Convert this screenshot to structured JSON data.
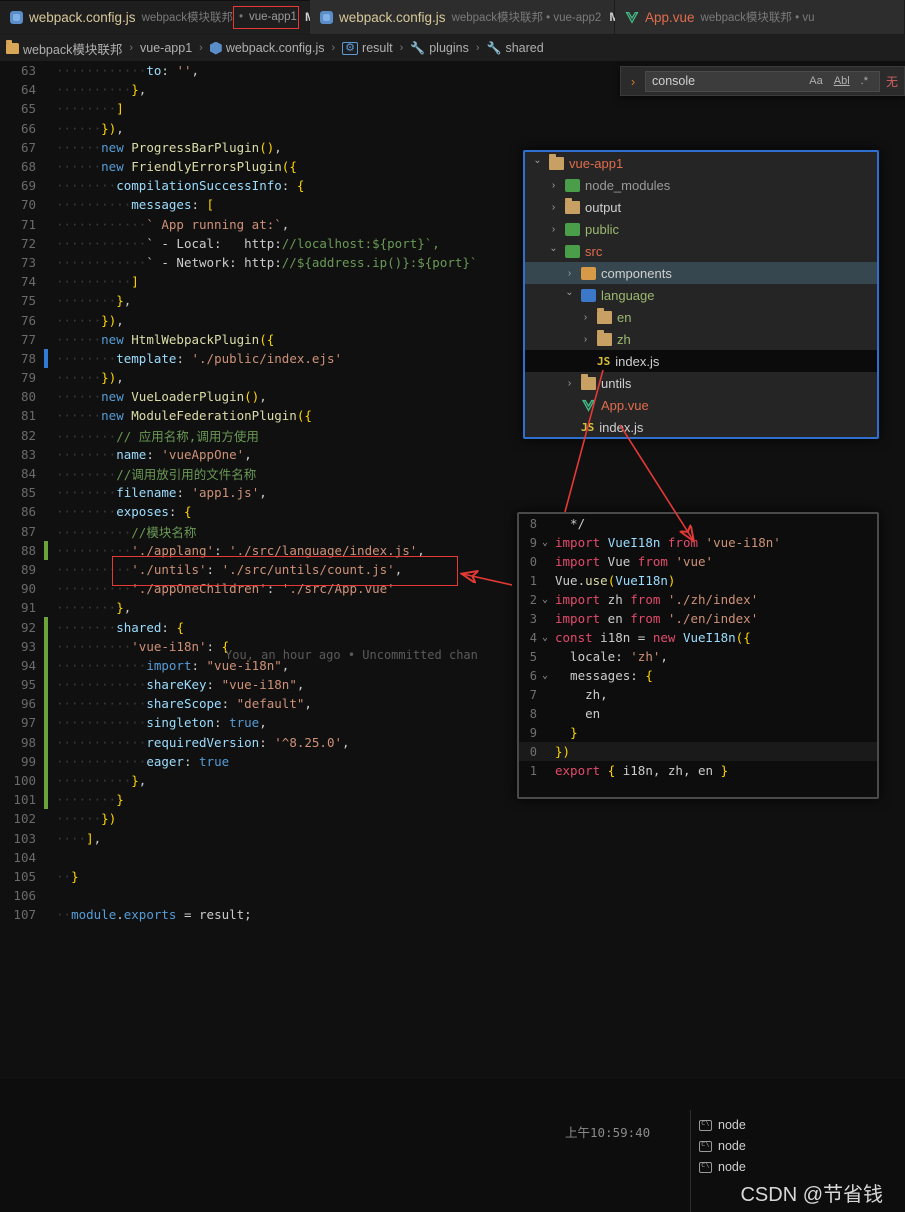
{
  "tabs": [
    {
      "icon": "js-file-icon",
      "name": "webpack.config.js",
      "desc": "webpack模块联邦",
      "sep": "•",
      "project": "vue-app1",
      "modified": "M",
      "close": "✕",
      "active": true
    },
    {
      "icon": "js-file-icon",
      "name": "webpack.config.js",
      "desc": "webpack模块联邦 • vue-app2",
      "modified": "M",
      "active": false
    },
    {
      "icon": "vue-file-icon",
      "name": "App.vue",
      "desc": "webpack模块联邦 • vu",
      "modified": "",
      "active": false
    }
  ],
  "breadcrumb": [
    {
      "icon": "folder-icon",
      "label": "webpack模块联邦"
    },
    {
      "icon": "none",
      "label": "vue-app1"
    },
    {
      "icon": "js-file-icon",
      "label": "webpack.config.js"
    },
    {
      "icon": "object-icon",
      "label": "result"
    },
    {
      "icon": "wrench-icon",
      "label": "plugins"
    },
    {
      "icon": "wrench-icon",
      "label": "shared"
    }
  ],
  "find_widget": {
    "chevron": "›",
    "query": "console",
    "opt_match_case": "Aa",
    "opt_whole_word": "Abl",
    "opt_regex": ".*",
    "result": "无"
  },
  "editor": {
    "blame_annotation": "You, an hour ago • Uncommitted chan",
    "lines": [
      {
        "n": 63,
        "mark": "",
        "text": "            to: '',"
      },
      {
        "n": 64,
        "mark": "",
        "text": "          },"
      },
      {
        "n": 65,
        "mark": "",
        "text": "        ]"
      },
      {
        "n": 66,
        "mark": "",
        "text": "      }),"
      },
      {
        "n": 67,
        "mark": "",
        "text": "      new ProgressBarPlugin(),"
      },
      {
        "n": 68,
        "mark": "",
        "text": "      new FriendlyErrorsPlugin({"
      },
      {
        "n": 69,
        "mark": "",
        "text": "        compilationSuccessInfo: {"
      },
      {
        "n": 70,
        "mark": "",
        "text": "          messages: ["
      },
      {
        "n": 71,
        "mark": "",
        "text": "            ` App running at:`,"
      },
      {
        "n": 72,
        "mark": "",
        "text": "            ` - Local:   http://localhost:${port}`,"
      },
      {
        "n": 73,
        "mark": "",
        "text": "            ` - Network: http://${address.ip()}:${port}`"
      },
      {
        "n": 74,
        "mark": "",
        "text": "          ]"
      },
      {
        "n": 75,
        "mark": "",
        "text": "        },"
      },
      {
        "n": 76,
        "mark": "",
        "text": "      }),"
      },
      {
        "n": 77,
        "mark": "",
        "text": "      new HtmlWebpackPlugin({"
      },
      {
        "n": 78,
        "mark": "blue",
        "text": "        template: './public/index.ejs'"
      },
      {
        "n": 79,
        "mark": "",
        "text": "      }),"
      },
      {
        "n": 80,
        "mark": "",
        "text": "      new VueLoaderPlugin(),"
      },
      {
        "n": 81,
        "mark": "",
        "text": "      new ModuleFederationPlugin({"
      },
      {
        "n": 82,
        "mark": "",
        "text": "        // 应用名称,调用方使用"
      },
      {
        "n": 83,
        "mark": "",
        "text": "        name: 'vueAppOne',"
      },
      {
        "n": 84,
        "mark": "",
        "text": "        //调用放引用的文件名称"
      },
      {
        "n": 85,
        "mark": "",
        "text": "        filename: 'app1.js',"
      },
      {
        "n": 86,
        "mark": "",
        "text": "        exposes: {"
      },
      {
        "n": 87,
        "mark": "",
        "text": "          //模块名称"
      },
      {
        "n": 88,
        "mark": "green",
        "text": "          './applang': './src/language/index.js',"
      },
      {
        "n": 89,
        "mark": "",
        "text": "          './untils': './src/untils/count.js',"
      },
      {
        "n": 90,
        "mark": "",
        "text": "          './appOneChildren': './src/App.vue'"
      },
      {
        "n": 91,
        "mark": "",
        "text": "        },"
      },
      {
        "n": 92,
        "mark": "green",
        "text": "        shared: {"
      },
      {
        "n": 93,
        "mark": "green",
        "text": "          'vue-i18n': {"
      },
      {
        "n": 94,
        "mark": "green",
        "text": "            import: \"vue-i18n\","
      },
      {
        "n": 95,
        "mark": "green",
        "text": "            shareKey: \"vue-i18n\","
      },
      {
        "n": 96,
        "mark": "green",
        "text": "            shareScope: \"default\","
      },
      {
        "n": 97,
        "mark": "green",
        "text": "            singleton: true,"
      },
      {
        "n": 98,
        "mark": "green",
        "text": "            requiredVersion: '^8.25.0',"
      },
      {
        "n": 99,
        "mark": "green",
        "text": "            eager: true"
      },
      {
        "n": 100,
        "mark": "green",
        "text": "          },"
      },
      {
        "n": 101,
        "mark": "green",
        "text": "        }"
      },
      {
        "n": 102,
        "mark": "",
        "text": "      })"
      },
      {
        "n": 103,
        "mark": "",
        "text": "    ],"
      },
      {
        "n": 104,
        "mark": "",
        "text": ""
      },
      {
        "n": 105,
        "mark": "",
        "text": "  }"
      },
      {
        "n": 106,
        "mark": "",
        "text": ""
      },
      {
        "n": 107,
        "mark": "",
        "text": "  module.exports = result;"
      }
    ]
  },
  "file_tree": {
    "rows": [
      {
        "indent": 0,
        "chev": "open",
        "icon": "folder-open-icon",
        "label": "vue-app1",
        "color": "red",
        "badge": ""
      },
      {
        "indent": 1,
        "chev": "closed",
        "icon": "node-modules-icon",
        "label": "node_modules",
        "color": "gry",
        "badge": ""
      },
      {
        "indent": 1,
        "chev": "closed",
        "icon": "folder-icon",
        "label": "output",
        "color": "wht",
        "badge": ""
      },
      {
        "indent": 1,
        "chev": "closed",
        "icon": "public-folder-icon",
        "label": "public",
        "color": "grn",
        "badge": ""
      },
      {
        "indent": 1,
        "chev": "open",
        "icon": "src-folder-icon",
        "label": "src",
        "color": "red",
        "badge": ""
      },
      {
        "indent": 2,
        "chev": "closed",
        "icon": "components-folder-icon",
        "label": "components",
        "color": "wht",
        "badge": "",
        "state": "selected"
      },
      {
        "indent": 2,
        "chev": "open",
        "icon": "language-folder-icon",
        "label": "language",
        "color": "grn",
        "badge": ""
      },
      {
        "indent": 3,
        "chev": "closed",
        "icon": "folder-icon",
        "label": "en",
        "color": "grn",
        "badge": ""
      },
      {
        "indent": 3,
        "chev": "closed",
        "icon": "folder-icon",
        "label": "zh",
        "color": "grn",
        "badge": ""
      },
      {
        "indent": 3,
        "chev": "none",
        "icon": "js-file-icon",
        "label": "index.js",
        "color": "wht",
        "badge": "JS",
        "state": "active"
      },
      {
        "indent": 2,
        "chev": "closed",
        "icon": "folder-icon",
        "label": "untils",
        "color": "wht",
        "badge": ""
      },
      {
        "indent": 2,
        "chev": "none",
        "icon": "vue-file-icon",
        "label": "App.vue",
        "color": "red",
        "badge": ""
      },
      {
        "indent": 2,
        "chev": "none",
        "icon": "js-file-icon",
        "label": "index.js",
        "color": "wht",
        "badge": "JS"
      }
    ]
  },
  "code_panel": {
    "lines": [
      {
        "n": "8",
        "fold": "",
        "text": "  */"
      },
      {
        "n": "9",
        "fold": "open",
        "text": "import VueI18n from 'vue-i18n'"
      },
      {
        "n": "0",
        "fold": "",
        "text": "import Vue from 'vue'"
      },
      {
        "n": "1",
        "fold": "",
        "text": "Vue.use(VueI18n)"
      },
      {
        "n": "2",
        "fold": "open",
        "text": "import zh from './zh/index'"
      },
      {
        "n": "3",
        "fold": "",
        "text": "import en from './en/index'"
      },
      {
        "n": "4",
        "fold": "open",
        "text": "const i18n = new VueI18n({"
      },
      {
        "n": "5",
        "fold": "",
        "text": "  locale: 'zh',"
      },
      {
        "n": "6",
        "fold": "open",
        "text": "  messages: {"
      },
      {
        "n": "7",
        "fold": "",
        "text": "    zh,"
      },
      {
        "n": "8",
        "fold": "",
        "text": "    en"
      },
      {
        "n": "9",
        "fold": "",
        "text": "  }"
      },
      {
        "n": "0",
        "fold": "",
        "text": "})"
      },
      {
        "n": "1",
        "fold": "",
        "text": "export { i18n, zh, en }"
      }
    ]
  },
  "bottom": {
    "timestamp": "上午10:59:40",
    "terminals": [
      {
        "icon": "terminal-icon",
        "label": "node"
      },
      {
        "icon": "terminal-icon",
        "label": "node"
      },
      {
        "icon": "terminal-icon",
        "label": "node"
      }
    ],
    "watermark": "CSDN @节省钱"
  },
  "colors": {
    "accent_blue": "#2f6fd0",
    "annotation_red": "#e53935",
    "tab_active_bg": "#1e1e1e",
    "editor_bg": "#101010"
  }
}
